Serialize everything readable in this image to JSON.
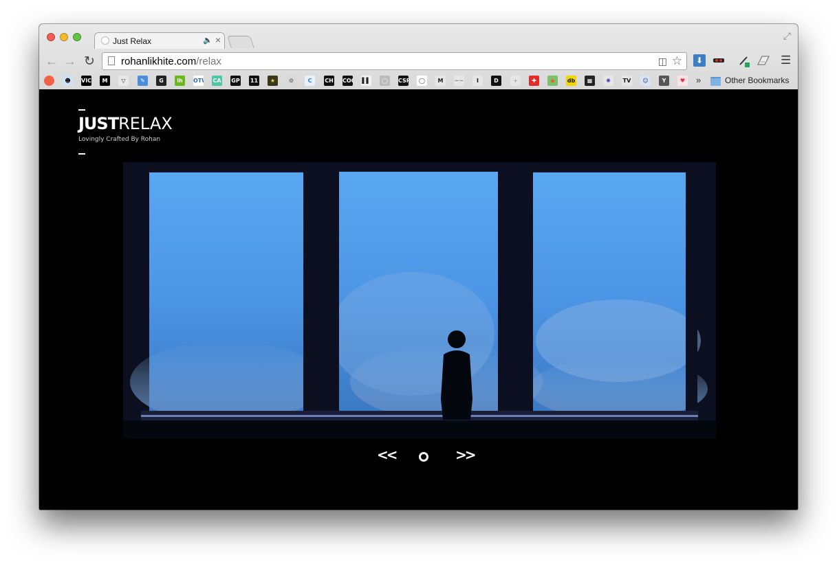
{
  "browser": {
    "tab_title": "Just Relax",
    "url_domain": "rohanlikhite.com",
    "url_path": "/relax",
    "other_bookmarks_label": "Other Bookmarks",
    "bookmarks_overflow": "»"
  },
  "bookmarks": [
    {
      "name": "bookmark-1",
      "label": "",
      "bg": "#f06445",
      "fg": "#fff"
    },
    {
      "name": "bookmark-reddit",
      "label": "☻",
      "bg": "#cee3f8",
      "fg": "#000"
    },
    {
      "name": "bookmark-vice",
      "label": "VICE",
      "bg": "#000",
      "fg": "#fff"
    },
    {
      "name": "bookmark-medium",
      "label": "M",
      "bg": "#000",
      "fg": "#fff"
    },
    {
      "name": "bookmark-v",
      "label": "▽",
      "bg": "#e8e8e8",
      "fg": "#222"
    },
    {
      "name": "bookmark-pen",
      "label": "✎",
      "bg": "#4a90d9",
      "fg": "#fff"
    },
    {
      "name": "bookmark-g",
      "label": "G",
      "bg": "#222",
      "fg": "#fff"
    },
    {
      "name": "bookmark-lh",
      "label": "lh",
      "bg": "#69b81d",
      "fg": "#fff"
    },
    {
      "name": "bookmark-otw",
      "label": "OTW",
      "bg": "#ffffff",
      "fg": "#2a6bb0"
    },
    {
      "name": "bookmark-casa",
      "label": "CA",
      "bg": "#4fc6a5",
      "fg": "#fff"
    },
    {
      "name": "bookmark-gp",
      "label": "GP",
      "bg": "#111",
      "fg": "#fff"
    },
    {
      "name": "bookmark-11",
      "label": "11",
      "bg": "#111",
      "fg": "#fff"
    },
    {
      "name": "bookmark-star",
      "label": "★",
      "bg": "#3a3a1a",
      "fg": "#f4d34a"
    },
    {
      "name": "bookmark-gear",
      "label": "⚙",
      "bg": "#d9d9d9",
      "fg": "#555"
    },
    {
      "name": "bookmark-c",
      "label": "C",
      "bg": "#e9f2fb",
      "fg": "#2a7bd0"
    },
    {
      "name": "bookmark-ch",
      "label": "CH",
      "bg": "#111",
      "fg": "#fff"
    },
    {
      "name": "bookmark-cool",
      "label": "COOL",
      "bg": "#111",
      "fg": "#fff"
    },
    {
      "name": "bookmark-chart",
      "label": "▌▌",
      "bg": "#f2f2f2",
      "fg": "#222"
    },
    {
      "name": "bookmark-circle",
      "label": "◯",
      "bg": "#bbbbbb",
      "fg": "#fff"
    },
    {
      "name": "bookmark-csp",
      "label": "CSP",
      "bg": "#111",
      "fg": "#fff"
    },
    {
      "name": "bookmark-ring",
      "label": "◯",
      "bg": "#ffffff",
      "fg": "#333"
    },
    {
      "name": "bookmark-m-serif",
      "label": "M",
      "bg": "#e6e6e6",
      "fg": "#222"
    },
    {
      "name": "bookmark-wave",
      "label": "~~",
      "bg": "#e6e6e6",
      "fg": "#777"
    },
    {
      "name": "bookmark-i",
      "label": "I",
      "bg": "#e6e6e6",
      "fg": "#111"
    },
    {
      "name": "bookmark-d",
      "label": "D",
      "bg": "#111",
      "fg": "#fff"
    },
    {
      "name": "bookmark-plus",
      "label": "+",
      "bg": "#e6e6e6",
      "fg": "#aaa"
    },
    {
      "name": "bookmark-swiss",
      "label": "✚",
      "bg": "#e32b2b",
      "fg": "#fff"
    },
    {
      "name": "bookmark-bird",
      "label": "◆",
      "bg": "#7cc06b",
      "fg": "#e0632d"
    },
    {
      "name": "bookmark-db",
      "label": "db",
      "bg": "#f2d600",
      "fg": "#111"
    },
    {
      "name": "bookmark-grid",
      "label": "▦",
      "bg": "#222",
      "fg": "#fff"
    },
    {
      "name": "bookmark-flower",
      "label": "✺",
      "bg": "#e6e6e6",
      "fg": "#4a3bb0"
    },
    {
      "name": "bookmark-tv",
      "label": "TV",
      "bg": "#e6e6e6",
      "fg": "#111"
    },
    {
      "name": "bookmark-person",
      "label": "☺",
      "bg": "#d7e4f5",
      "fg": "#335"
    },
    {
      "name": "bookmark-y",
      "label": "Y",
      "bg": "#555",
      "fg": "#fff"
    },
    {
      "name": "bookmark-heart",
      "label": "♥",
      "bg": "#fbe3e6",
      "fg": "#e0314a"
    }
  ],
  "logo": {
    "just": "JUST",
    "relax": "RELAX",
    "tagline": "Lovingly Crafted By Rohan"
  },
  "slider": {
    "prev_label": "<<",
    "next_label": ">>"
  },
  "colors": {
    "page_background": "#000000",
    "sky": "#5ea8f0",
    "window_frame": "#0d1120"
  }
}
